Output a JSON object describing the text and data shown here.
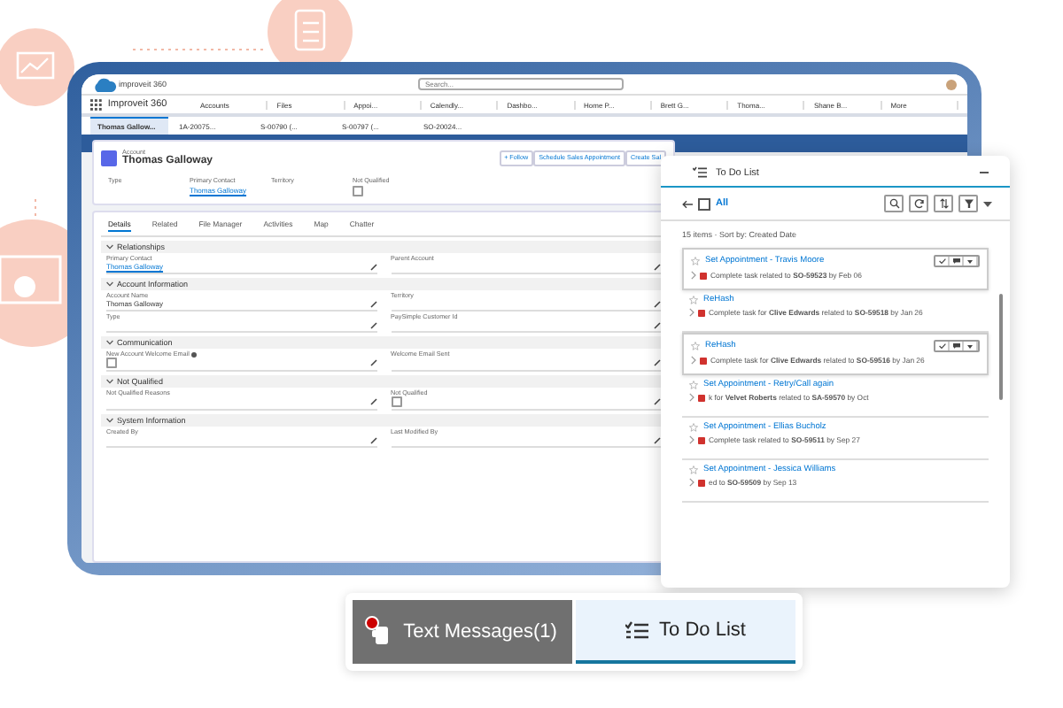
{
  "app": {
    "logo": "improveit 360",
    "search_placeholder": "Search...",
    "app_name": "Improveit 360",
    "nav_tabs": [
      "Accounts",
      "Files",
      "Appoi...",
      "Calendly...",
      "Dashbo...",
      "Home P...",
      "Brett G...",
      "Thoma...",
      "Shane B...",
      "More"
    ],
    "subtabs": [
      {
        "label": "Thomas Gallow...",
        "selected": true
      },
      {
        "label": "1A-20075...",
        "selected": false
      },
      {
        "label": "S-00790 (...",
        "selected": false
      },
      {
        "label": "S-00797 (...",
        "selected": false
      },
      {
        "label": "SO-20024...",
        "selected": false
      }
    ],
    "record": {
      "object": "Account",
      "name": "Thomas Galloway",
      "actions": [
        "+ Follow",
        "Schedule Sales Appointment",
        "Create Sal"
      ],
      "highlights": [
        {
          "label": "Type",
          "kind": "text"
        },
        {
          "label": "Primary Contact",
          "kind": "link",
          "value": "Thomas Galloway"
        },
        {
          "label": "Territory",
          "kind": "text"
        },
        {
          "label": "Not Qualified",
          "kind": "checkbox",
          "checked": false
        }
      ]
    },
    "tabs": [
      {
        "label": "Details",
        "selected": true
      },
      {
        "label": "Related",
        "selected": false
      },
      {
        "label": "File Manager",
        "selected": false
      },
      {
        "label": "Activities",
        "selected": false
      },
      {
        "label": "Map",
        "selected": false
      },
      {
        "label": "Chatter",
        "selected": false
      }
    ],
    "sections": [
      {
        "title": "Relationships",
        "expanded": true,
        "fields": [
          {
            "label": "Primary Contact",
            "kind": "link",
            "value": "Thomas Galloway"
          },
          {
            "label": "Parent Account",
            "kind": "text"
          }
        ]
      },
      {
        "title": "Account Information",
        "expanded": true,
        "fields": [
          {
            "label": "Account Name",
            "kind": "text",
            "value": "Thomas Galloway"
          },
          {
            "label": "Territory",
            "kind": "text"
          },
          {
            "label": "Type",
            "kind": "text"
          },
          {
            "label": "PaySimple Customer Id",
            "kind": "text"
          }
        ]
      },
      {
        "title": "Communication",
        "expanded": true,
        "fields": [
          {
            "label": "New Account Welcome Email",
            "kind": "checkbox",
            "checked": false,
            "info": true
          },
          {
            "label": "Welcome Email Sent",
            "kind": "text"
          }
        ]
      },
      {
        "title": "Not Qualified",
        "expanded": true,
        "fields": [
          {
            "label": "Not Qualified Reasons",
            "kind": "text"
          },
          {
            "label": "Not Qualified",
            "kind": "checkbox",
            "checked": false
          }
        ]
      },
      {
        "title": "System Information",
        "expanded": true,
        "fields": [
          {
            "label": "Created By",
            "kind": "text"
          },
          {
            "label": "Last Modified By",
            "kind": "text"
          }
        ]
      }
    ]
  },
  "todo": {
    "title": "To Do List",
    "view": "All",
    "summary": "15 items · Sort by: Created Date",
    "items": [
      {
        "title": "Set Appointment - Travis Moore",
        "description": "Complete task related to **SO-59523** by Feb 06",
        "selected": true
      },
      {
        "title": "ReHash",
        "description": "Complete task for **Clive Edwards** related to **SO-59518** by Jan 26",
        "selected": false
      },
      {
        "title": "ReHash",
        "description": "Complete task for **Clive Edwards** related to **SO-59516** by Jan 26",
        "selected": true
      },
      {
        "title": "Set Appointment - Retry/Call again",
        "description": "k for **Velvet Roberts** related to **SA-59570** by Oct",
        "selected": false
      },
      {
        "title": "Set Appointment - Ellias Bucholz",
        "description": "Complete task related to **SO-59511** by Sep 27",
        "selected": false
      },
      {
        "title": "Set Appointment - Jessica Williams",
        "description": "ed to **SO-59509** by Sep 13",
        "selected": false
      }
    ]
  },
  "utility_bar": [
    {
      "label": "Text Messages(1)",
      "kind": "messages",
      "unread": true,
      "selected": false
    },
    {
      "label": "To Do List",
      "kind": "todo",
      "selected": true
    }
  ]
}
